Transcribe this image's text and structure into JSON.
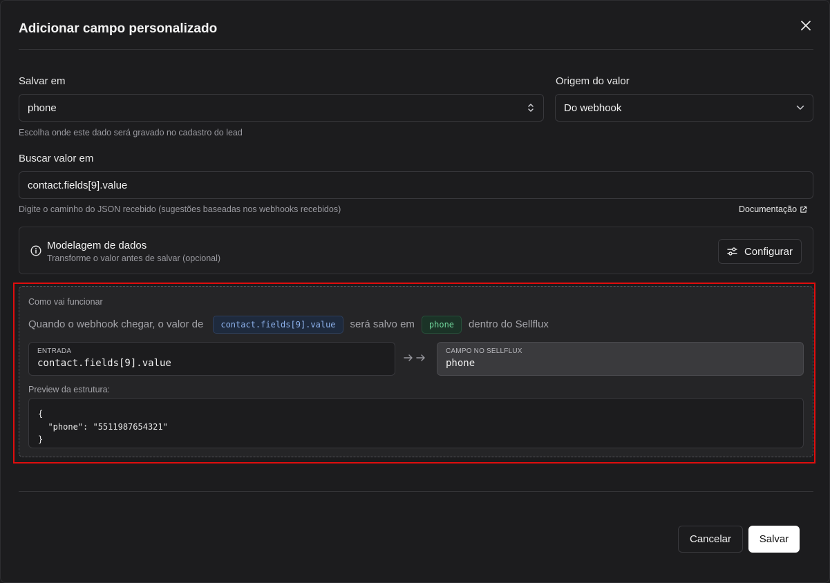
{
  "dialog": {
    "title": "Adicionar campo personalizado",
    "close_icon": "close-icon"
  },
  "save_in": {
    "label": "Salvar em",
    "value": "phone",
    "hint": "Escolha onde este dado será gravado no cadastro do lead",
    "icon": "chevron-up-down-icon"
  },
  "origin": {
    "label": "Origem do valor",
    "value": "Do webhook",
    "icon": "chevron-down-icon"
  },
  "lookup": {
    "label": "Buscar valor em",
    "value": "contact.fields[9].value",
    "hint": "Digite o caminho do JSON recebido (sugestões baseadas nos webhooks recebidos)",
    "doc_link": "Documentação",
    "doc_icon": "external-link-icon"
  },
  "modeling": {
    "title": "Modelagem de dados",
    "subtitle": "Transforme o valor antes de salvar (opcional)",
    "button": "Configurar",
    "info_icon": "info-icon",
    "button_icon": "sliders-icon"
  },
  "how_it_works": {
    "title": "Como vai funcionar",
    "sentence": {
      "part1": "Quando o webhook chegar,",
      "part2": "o valor de",
      "source_chip": "contact.fields[9].value",
      "part3": "será salvo em",
      "target_chip": "phone",
      "part4": "dentro do Sellflux"
    },
    "input": {
      "caption": "ENTRADA",
      "value": "contact.fields[9].value"
    },
    "output": {
      "caption": "CAMPO NO SELLFLUX",
      "value": "phone"
    },
    "preview_label": "Preview da estrutura:",
    "preview_lines": [
      "{",
      "  \"phone\": \"5511987654321\"",
      "}"
    ]
  },
  "footer": {
    "cancel": "Cancelar",
    "save": "Salvar"
  },
  "colors": {
    "background": "#1c1c1e",
    "highlight_border": "#e00d0d",
    "chip_blue_text": "#8fb4ef",
    "chip_green_text": "#6fd49a"
  }
}
